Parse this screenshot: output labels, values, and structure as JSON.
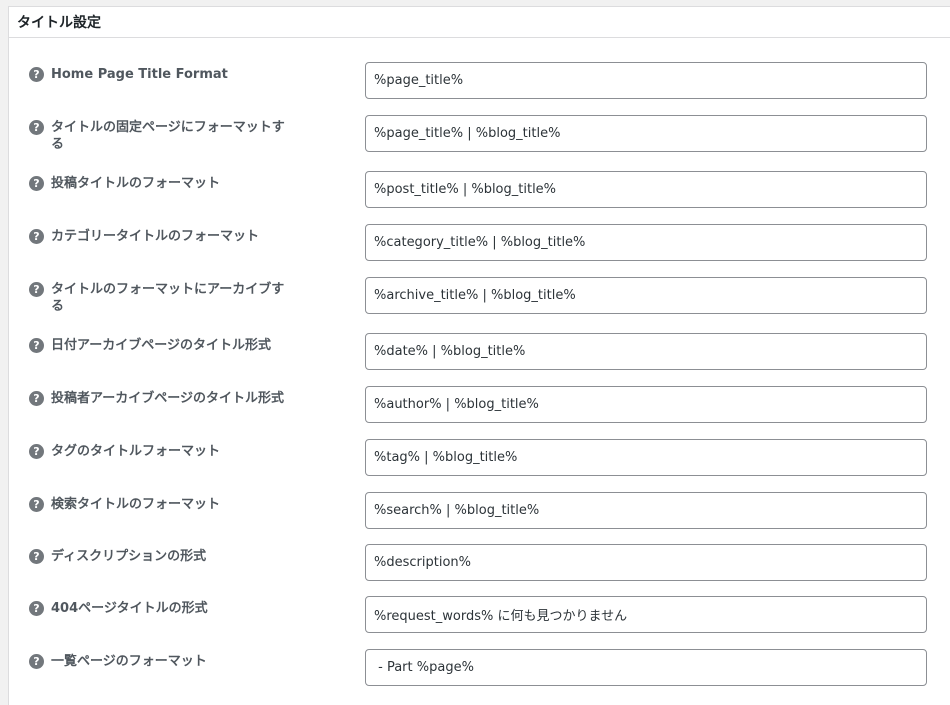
{
  "section": {
    "title": "タイトル設定"
  },
  "fields": [
    {
      "label": "Home Page Title Format",
      "value": "%page_title%"
    },
    {
      "label": "タイトルの固定ページにフォーマットする",
      "value": "%page_title% | %blog_title%"
    },
    {
      "label": "投稿タイトルのフォーマット",
      "value": "%post_title% | %blog_title%"
    },
    {
      "label": "カテゴリータイトルのフォーマット",
      "value": "%category_title% | %blog_title%"
    },
    {
      "label": "タイトルのフォーマットにアーカイブする",
      "value": "%archive_title% | %blog_title%"
    },
    {
      "label": "日付アーカイブページのタイトル形式",
      "value": "%date% | %blog_title%"
    },
    {
      "label": "投稿者アーカイブページのタイトル形式",
      "value": "%author% | %blog_title%"
    },
    {
      "label": "タグのタイトルフォーマット",
      "value": "%tag% | %blog_title%"
    },
    {
      "label": "検索タイトルのフォーマット",
      "value": "%search% | %blog_title%"
    },
    {
      "label": "ディスクリプションの形式",
      "value": "%description%"
    },
    {
      "label": "404ページタイトルの形式",
      "value": "%request_words% に何も見つかりません"
    },
    {
      "label": "一覧ページのフォーマット",
      "value": " - Part %page%"
    }
  ],
  "icons": {
    "help": "question-circle-icon",
    "help_glyph": "?"
  }
}
